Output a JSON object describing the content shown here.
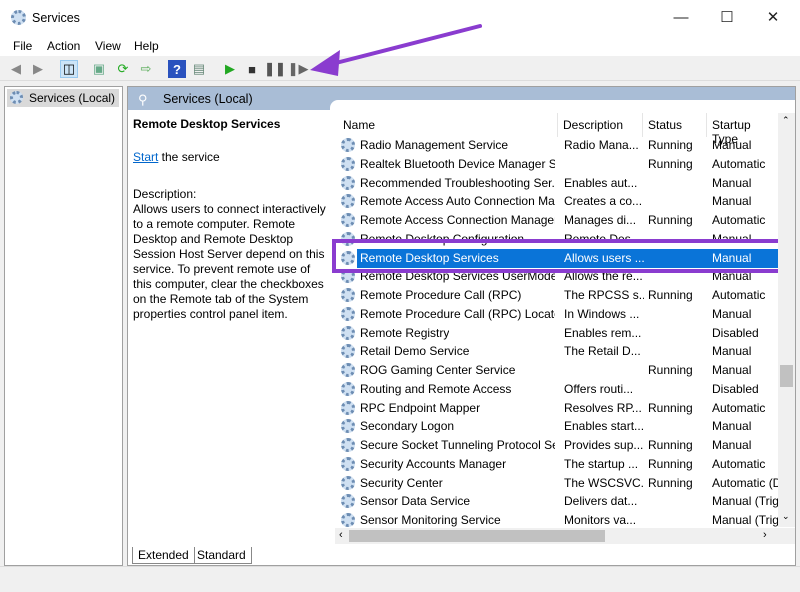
{
  "window": {
    "title": "Services",
    "icon": "gear-icon"
  },
  "menu": [
    "File",
    "Action",
    "View",
    "Help"
  ],
  "toolbar": {
    "icons": [
      "back-icon",
      "forward-icon",
      "show-hide-tree-icon",
      "properties-icon",
      "refresh-icon",
      "export-icon",
      "help-icon",
      "console-icon",
      "start-icon",
      "stop-icon",
      "pause-icon",
      "resume-icon"
    ]
  },
  "tree": {
    "root": "Services (Local)"
  },
  "pane": {
    "header": "Services (Local)"
  },
  "details": {
    "title": "Remote Desktop Services",
    "start_link": "Start",
    "start_suffix": " the service",
    "desc_label": "Description:",
    "desc_text": "Allows users to connect interactively to a remote computer. Remote Desktop and Remote Desktop Session Host Server depend on this service. To prevent remote use of this computer, clear the checkboxes on the Remote tab of the System properties control panel item."
  },
  "columns": [
    "Name",
    "Description",
    "Status",
    "Startup Type"
  ],
  "rows": [
    [
      "Radio Management Service",
      "Radio Mana...",
      "Running",
      "Manual"
    ],
    [
      "Realtek Bluetooth Device Manager S...",
      "",
      "Running",
      "Automatic"
    ],
    [
      "Recommended Troubleshooting Ser...",
      "Enables aut...",
      "",
      "Manual"
    ],
    [
      "Remote Access Auto Connection Ma...",
      "Creates a co...",
      "",
      "Manual"
    ],
    [
      "Remote Access Connection Manager",
      "Manages di...",
      "Running",
      "Automatic"
    ],
    [
      "Remote Desktop Configuration",
      "Remote Des...",
      "",
      "Manual"
    ],
    [
      "Remote Desktop Services",
      "Allows users ...",
      "",
      "Manual"
    ],
    [
      "Remote Desktop Services UserMode ...",
      "Allows the re...",
      "",
      "Manual"
    ],
    [
      "Remote Procedure Call (RPC)",
      "The RPCSS s...",
      "Running",
      "Automatic"
    ],
    [
      "Remote Procedure Call (RPC) Locator",
      "In Windows ...",
      "",
      "Manual"
    ],
    [
      "Remote Registry",
      "Enables rem...",
      "",
      "Disabled"
    ],
    [
      "Retail Demo Service",
      "The Retail D...",
      "",
      "Manual"
    ],
    [
      "ROG Gaming Center Service",
      "",
      "Running",
      "Manual"
    ],
    [
      "Routing and Remote Access",
      "Offers routi...",
      "",
      "Disabled"
    ],
    [
      "RPC Endpoint Mapper",
      "Resolves RP...",
      "Running",
      "Automatic"
    ],
    [
      "Secondary Logon",
      "Enables start...",
      "",
      "Manual"
    ],
    [
      "Secure Socket Tunneling Protocol Se...",
      "Provides sup...",
      "Running",
      "Manual"
    ],
    [
      "Security Accounts Manager",
      "The startup ...",
      "Running",
      "Automatic"
    ],
    [
      "Security Center",
      "The WSCSVC...",
      "Running",
      "Automatic (D"
    ],
    [
      "Sensor Data Service",
      "Delivers dat...",
      "",
      "Manual (Trig"
    ],
    [
      "Sensor Monitoring Service",
      "Monitors va...",
      "",
      "Manual (Trig"
    ]
  ],
  "selected_row": "Remote Desktop Services",
  "tabs": [
    "Extended",
    "Standard"
  ],
  "colors": {
    "selection": "#0a74d8",
    "highlight_annotation": "#8a3ccf",
    "header_band": "#a9bdd6"
  }
}
